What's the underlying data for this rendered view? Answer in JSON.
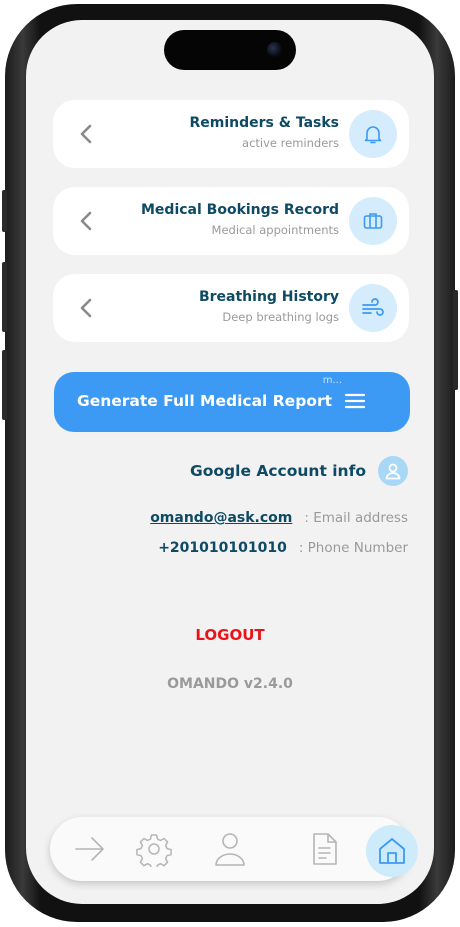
{
  "cards": [
    {
      "title": "Reminders & Tasks",
      "subtitle": "active reminders",
      "icon": "bell-icon"
    },
    {
      "title": "Medical Bookings Record",
      "subtitle": "Medical appointments",
      "icon": "briefcase-icon"
    },
    {
      "title": "Breathing History",
      "subtitle": "Deep breathing logs",
      "icon": "wind-icon"
    }
  ],
  "generate_report": {
    "label": "Generate Full Medical Report",
    "overflow_hint": "m...",
    "icon": "menu-icon"
  },
  "account": {
    "heading": "Google Account info",
    "icon": "user-icon",
    "email": {
      "value": "omando@ask.com",
      "label": ": Email address"
    },
    "phone": {
      "value": "+201010101010",
      "label": ": Phone Number"
    }
  },
  "logout_label": "LOGOUT",
  "version_label": "OMANDO v2.4.0",
  "tabbar": {
    "items": [
      {
        "icon": "arrow-right-icon"
      },
      {
        "icon": "gear-icon"
      },
      {
        "icon": "user-icon"
      },
      {
        "icon": "document-icon"
      },
      {
        "icon": "home-icon",
        "active": true
      }
    ]
  },
  "colors": {
    "accent": "#3c9af5",
    "title_text": "#0e4a63",
    "muted_text": "#9a9a9a",
    "logout": "#e8141a",
    "icon_bg": "#d4ecfb",
    "screen_bg": "#f2f2f2"
  }
}
